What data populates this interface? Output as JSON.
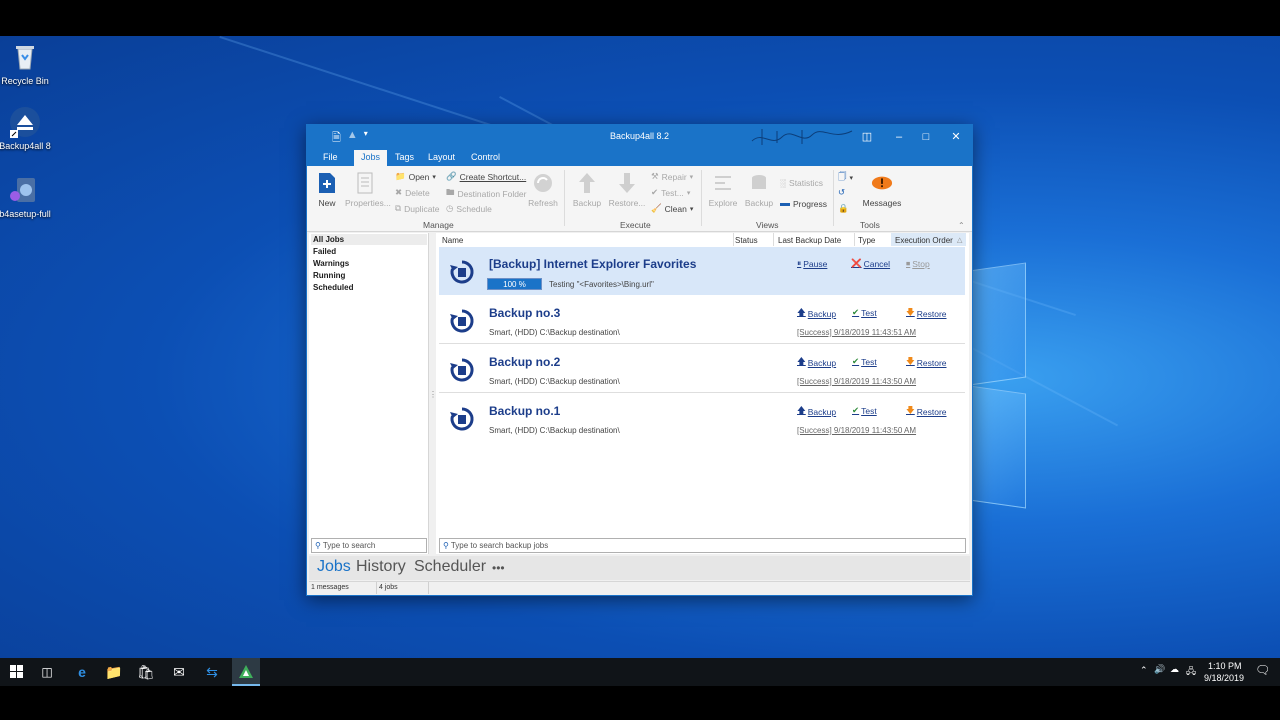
{
  "desktop": {
    "icons": [
      {
        "label": "Recycle Bin",
        "icon": "recycle-bin-icon"
      },
      {
        "label": "Backup4all 8",
        "icon": "backup4all-shortcut-icon"
      },
      {
        "label": "b4asetup-full",
        "icon": "setup-installer-icon"
      }
    ]
  },
  "app": {
    "title": "Backup4all 8.2",
    "menu": [
      "File",
      "Jobs",
      "Tags",
      "Layout",
      "Control"
    ],
    "active_menu": "Jobs",
    "ribbon": {
      "manage": {
        "label": "Manage",
        "new": "New",
        "properties": "Properties...",
        "open": "Open",
        "delete": "Delete",
        "duplicate": "Duplicate",
        "create_shortcut": "Create Shortcut...",
        "destination_folder": "Destination Folder",
        "schedule": "Schedule",
        "refresh": "Refresh"
      },
      "execute": {
        "label": "Execute",
        "backup": "Backup",
        "restore": "Restore...",
        "repair": "Repair",
        "test": "Test...",
        "clean": "Clean"
      },
      "views": {
        "label": "Views",
        "explore": "Explore",
        "backup": "Backup",
        "statistics": "Statistics",
        "progress": "Progress"
      },
      "tools": {
        "label": "Tools",
        "messages": "Messages"
      }
    },
    "filters": [
      "All Jobs",
      "Failed",
      "Warnings",
      "Running",
      "Scheduled"
    ],
    "columns": [
      "Name",
      "Status",
      "Last Backup Date",
      "Type",
      "Execution Order"
    ],
    "jobs": [
      {
        "title": "[Backup] Internet Explorer Favorites",
        "progress_text": "100 %",
        "progress": 1.0,
        "status_text": "Testing \"<Favorites>\\Bing.url\"",
        "actions": [
          "Pause",
          "Cancel",
          "Stop"
        ]
      },
      {
        "title": "Backup no.3",
        "subtitle": "Smart, (HDD) C:\\Backup destination\\",
        "actions": [
          "Backup",
          "Test",
          "Restore"
        ],
        "last_result": "[Success] 9/18/2019 11:43:51 AM"
      },
      {
        "title": "Backup no.2",
        "subtitle": "Smart, (HDD) C:\\Backup destination\\",
        "actions": [
          "Backup",
          "Test",
          "Restore"
        ],
        "last_result": "[Success] 9/18/2019 11:43:50 AM"
      },
      {
        "title": "Backup no.1",
        "subtitle": "Smart, (HDD) C:\\Backup destination\\",
        "actions": [
          "Backup",
          "Test",
          "Restore"
        ],
        "last_result": "[Success] 9/18/2019 11:43:50 AM"
      }
    ],
    "left_search_placeholder": "Type to search",
    "main_search_placeholder": "Type to search backup jobs",
    "nav": [
      "Jobs",
      "History",
      "Scheduler",
      "•••"
    ],
    "status": {
      "messages": "1 messages",
      "jobs": "4 jobs"
    }
  },
  "taskbar": {
    "time": "1:10 PM",
    "date": "9/18/2019"
  },
  "colors": {
    "accent": "#1a73c8",
    "job_title": "#1c3d8a",
    "running_bg": "#d8e7f9"
  }
}
